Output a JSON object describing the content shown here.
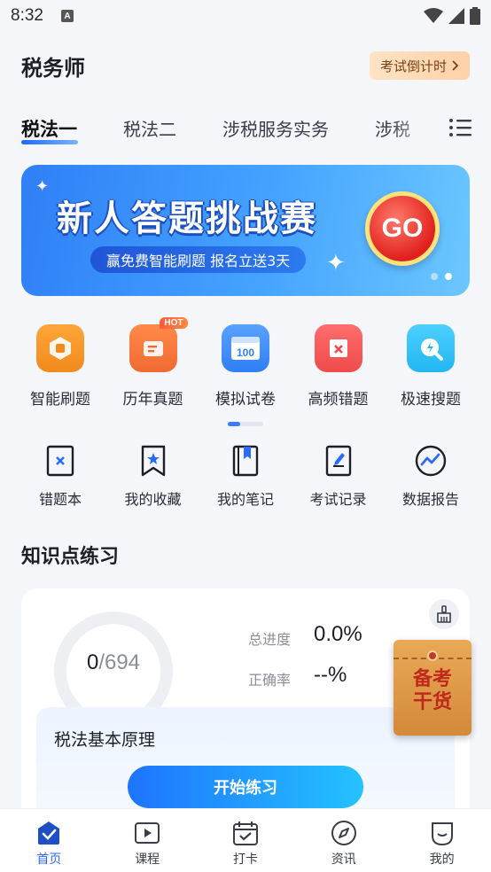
{
  "status_bar": {
    "time": "8:32",
    "notification_badge": "A"
  },
  "header": {
    "title": "税务师",
    "countdown_label": "考试倒计时"
  },
  "tabs": [
    {
      "label": "税法一",
      "active": true
    },
    {
      "label": "税法二",
      "active": false
    },
    {
      "label": "涉税服务实务",
      "active": false
    },
    {
      "label": "涉税",
      "active": false
    }
  ],
  "banner": {
    "headline": "新人答题挑战赛",
    "subtitle": "赢免费智能刷题 报名立送3天",
    "go_label": "GO",
    "page_count": 2,
    "current_page": 2
  },
  "features": [
    {
      "label": "智能刷题",
      "icon": "smart-practice-icon",
      "color": "#f08a1c"
    },
    {
      "label": "历年真题",
      "icon": "past-papers-icon",
      "color": "#f06a32",
      "badge": "HOT"
    },
    {
      "label": "模拟试卷",
      "icon": "mock-exam-icon",
      "color": "#2f7ff6",
      "icon_text": "100"
    },
    {
      "label": "高频错题",
      "icon": "frequent-errors-icon",
      "color": "#f04b4b"
    },
    {
      "label": "极速搜题",
      "icon": "quick-search-icon",
      "color": "#22b6f0"
    }
  ],
  "tools": [
    {
      "label": "错题本",
      "icon": "error-book-icon"
    },
    {
      "label": "我的收藏",
      "icon": "bookmark-icon"
    },
    {
      "label": "我的笔记",
      "icon": "notebook-icon"
    },
    {
      "label": "考试记录",
      "icon": "exam-record-icon"
    },
    {
      "label": "数据报告",
      "icon": "data-report-icon"
    }
  ],
  "knowledge": {
    "section_title": "知识点练习",
    "done": "0",
    "total": "/694",
    "progress_label": "总进度",
    "progress_value": "0.0%",
    "accuracy_label": "正确率",
    "accuracy_value": "--%",
    "topic_name": "税法基本原理",
    "start_label": "开始练习"
  },
  "promo": {
    "text_line1": "备考",
    "text_line2": "干货"
  },
  "bottom_nav": [
    {
      "label": "首页",
      "icon": "home-icon",
      "active": true
    },
    {
      "label": "课程",
      "icon": "course-icon",
      "active": false
    },
    {
      "label": "打卡",
      "icon": "checkin-icon",
      "active": false
    },
    {
      "label": "资讯",
      "icon": "news-icon",
      "active": false
    },
    {
      "label": "我的",
      "icon": "profile-icon",
      "active": false
    }
  ],
  "colors": {
    "accent": "#2a6bff",
    "background": "#f5f6fa"
  }
}
